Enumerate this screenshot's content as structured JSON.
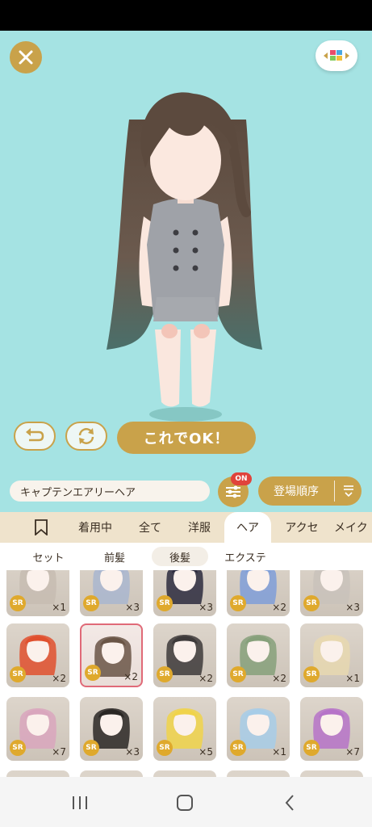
{
  "toolbar": {
    "ok_label": "これでOK！"
  },
  "item_name": "キャプテンエアリーヘア",
  "filter_badge": "ON",
  "sort_label": "登場順序",
  "tabs": [
    {
      "label": "",
      "icon": "bookmark-icon"
    },
    {
      "label": "着用中"
    },
    {
      "label": "全て"
    },
    {
      "label": "洋服"
    },
    {
      "label": "ヘア",
      "active": true
    },
    {
      "label": "アクセ"
    },
    {
      "label": "メイク"
    }
  ],
  "subtabs": [
    {
      "label": "セット"
    },
    {
      "label": "前髪"
    },
    {
      "label": "後髪",
      "active": true
    },
    {
      "label": "エクステ"
    }
  ],
  "items": [
    {
      "rarity": "SR",
      "count": "×1",
      "color": "#c7bcb2"
    },
    {
      "rarity": "SR",
      "count": "×3",
      "color": "#a9b6cf"
    },
    {
      "rarity": "SR",
      "count": "×3",
      "color": "#2b2a3d"
    },
    {
      "rarity": "SR",
      "count": "×2",
      "color": "#7f9ed8"
    },
    {
      "rarity": "SR",
      "count": "×3",
      "color": "#c9c2bb"
    },
    {
      "rarity": "SR",
      "count": "×2",
      "color": "#e0502e"
    },
    {
      "rarity": "SR",
      "count": "×2",
      "color": "#6a5546",
      "selected": true
    },
    {
      "rarity": "SR",
      "count": "×2",
      "color": "#3d3a3a"
    },
    {
      "rarity": "SR",
      "count": "×2",
      "color": "#86a07a"
    },
    {
      "rarity": "SR",
      "count": "×1",
      "color": "#e8d8b0"
    },
    {
      "rarity": "SR",
      "count": "×7",
      "color": "#d9a6bd"
    },
    {
      "rarity": "SR",
      "count": "×3",
      "color": "#2a2724"
    },
    {
      "rarity": "SR",
      "count": "×5",
      "color": "#f0d34a"
    },
    {
      "rarity": "SR",
      "count": "×1",
      "color": "#a7cde8"
    },
    {
      "rarity": "SR",
      "count": "×7",
      "color": "#b673c8"
    }
  ],
  "colors": {
    "stage": "#a5e3e3",
    "accent": "#c9a24a",
    "tab_bg": "#efe3cc",
    "badge": "#e0433b",
    "selected_border": "#e06a78"
  }
}
